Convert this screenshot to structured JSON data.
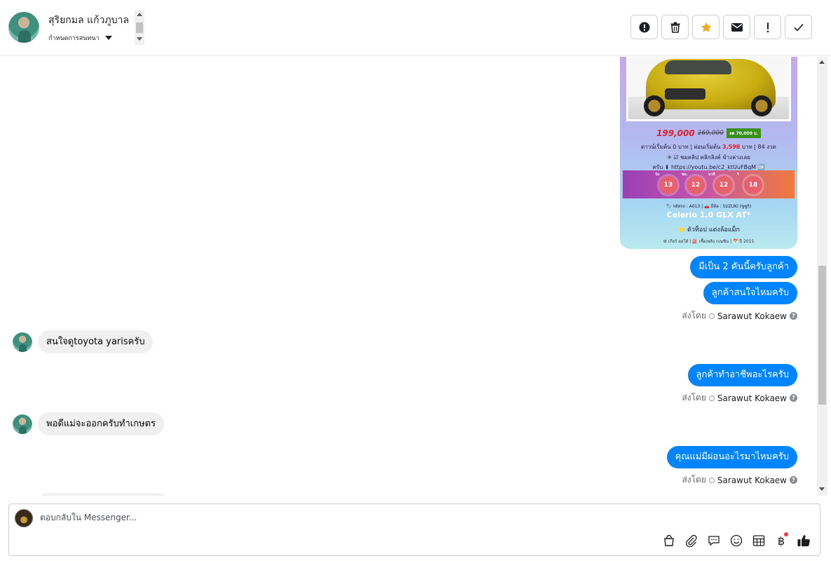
{
  "header": {
    "contact_name": "สุริยกมล แก้วภูบาล",
    "conversation_menu_label": "กำหนดการสนทนา"
  },
  "toolbar": {
    "icons": [
      "alert-circle-icon",
      "trash-icon",
      "star-icon",
      "envelope-icon",
      "exclamation-icon",
      "check-icon"
    ],
    "star_color": "#f5a623"
  },
  "product_card": {
    "price_now": "199,000",
    "price_old": "269,000",
    "price_badge": "ลด 70,000 บ.",
    "down_payment_line": "ดาวน์เริ่มต้น 0 บาท | ผ่อนเริ่มต้น",
    "installment": "3,598",
    "installment_suffix": "บาท | 84 งวด",
    "clip_line": "✳ ☑ ชมคลิป คลิกลิงค์ ข้างล่างเลย",
    "link_line": "ครับ ⬇ https://youtu.be/c2_ktUuFBqM 🆗",
    "countdown": [
      {
        "label": "วัน",
        "value": "13"
      },
      {
        "label": "ชม.",
        "value": "12"
      },
      {
        "label": "นาที",
        "value": "12"
      },
      {
        "label": "วิ",
        "value": "18"
      }
    ],
    "code_line": "🏷 รหัสรถ : A013 | 🚗 ยี่ห้อ : SUZUKI (ซูซูกิ)",
    "model": "Celerio 1.0 GLX AT*",
    "feature_line": "⭐ ตัวท็อป แต่งล้อแม็ก",
    "footer_line": "⚙ เกียร์ ออโต้  |  ⛽ เชื้อเพลิง เบนซิน  |  📅 ปี 2015"
  },
  "messages": {
    "out_1": "มีเป็น 2 คันนี้ครับลูกค้า",
    "out_2": "ลูกค้าสนใจไหมครับ",
    "in_1": "สนใจดูtoyota yarisครับ",
    "out_3": "ลูกค้าทำอาชีพอะไรครับ",
    "in_2": "พอดีแม่จะออกครับทำเกษตร",
    "out_4": "คุณแม่มีผ่อนอะไรมาไหมครับ",
    "sent_by_prefix": "ส่งโดย",
    "agent_name": "Sarawut Kokaew"
  },
  "composer": {
    "placeholder": "ตอบกลับใน Messenger...",
    "tools": [
      "shopping-bag-icon",
      "paperclip-icon",
      "saved-reply-icon",
      "emoji-icon",
      "calendar-table-icon",
      "baht-icon",
      "thumbs-up-icon"
    ],
    "accent": "#1877f2"
  }
}
